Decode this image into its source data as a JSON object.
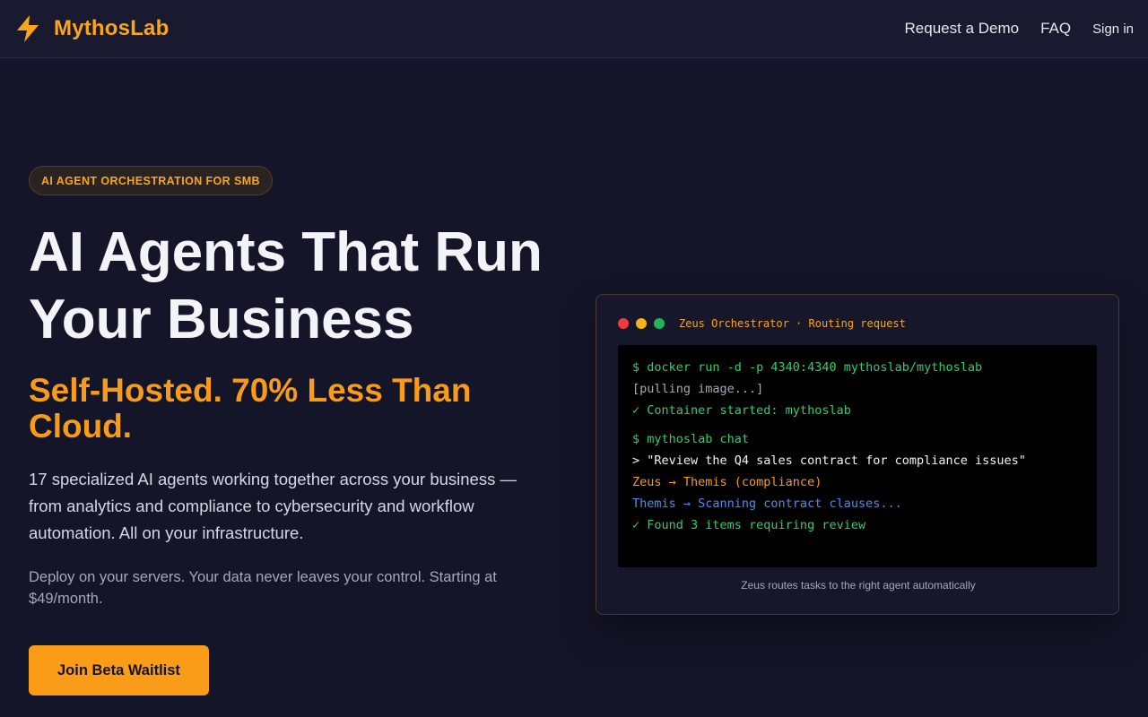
{
  "nav": {
    "brand": "MythosLab",
    "links": [
      "Request a Demo",
      "FAQ"
    ],
    "sign_in": "Sign in"
  },
  "hero": {
    "badge": "AI AGENT ORCHESTRATION FOR SMB",
    "headline_line1": "AI Agents That Run",
    "headline_line2": "Your Business",
    "subheadline": "Self-Hosted. 70% Less Than Cloud.",
    "lead": "17 specialized AI agents working together across your business — from analytics and compliance to cybersecurity and workflow automation. All on your infrastructure.",
    "sub": "Deploy on your servers. Your data never leaves your control. Starting at $49/month.",
    "cta": "Join Beta Waitlist"
  },
  "terminal": {
    "title": "Zeus Orchestrator · Routing request",
    "lines": [
      "$ docker run -d -p 4340:4340 mythoslab/mythoslab",
      "[pulling image...]",
      "✓ Container started: mythoslab",
      "$ mythoslab chat",
      "> \"Review the Q4 sales contract for compliance issues\"",
      "Zeus → Themis (compliance)",
      "Themis → Scanning contract clauses...",
      "✓ Found 3 items requiring review"
    ],
    "caption": "Zeus routes tasks to the right agent automatically"
  },
  "colors": {
    "accent": "#f99b1a",
    "background": "#141528",
    "terminal_green": "#2fcf6a",
    "terminal_blue": "#4f8cf2",
    "dot_red": "#ef3b3b",
    "dot_yellow": "#f3b515",
    "dot_green": "#1fb65a"
  },
  "icons": {
    "brand": "lightning-bolt-icon"
  }
}
